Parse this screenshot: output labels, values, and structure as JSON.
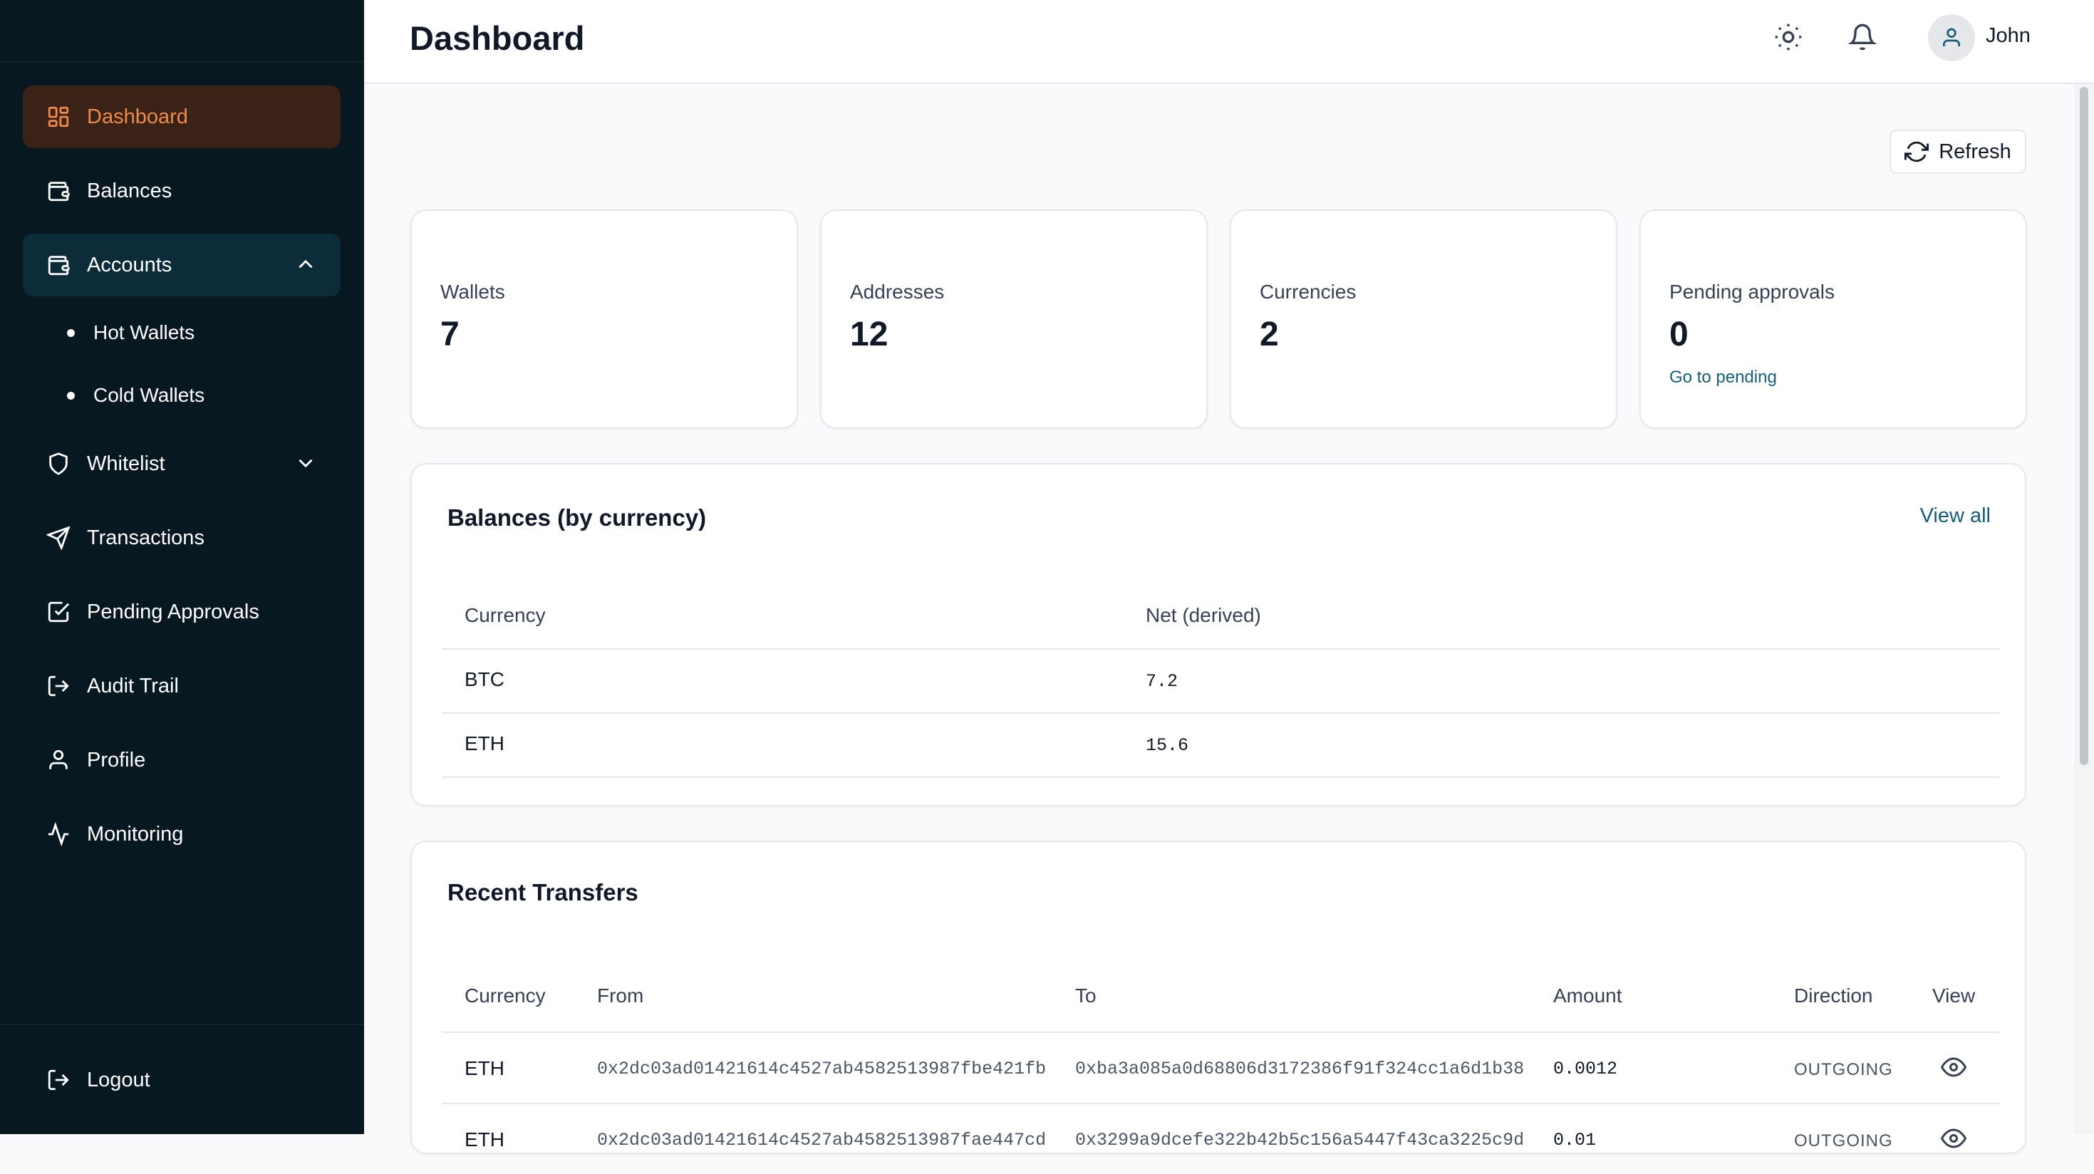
{
  "sidebar": {
    "items": [
      {
        "label": "Dashboard",
        "icon": "grid-icon"
      },
      {
        "label": "Balances",
        "icon": "wallet-icon"
      },
      {
        "label": "Accounts",
        "icon": "wallet-icon"
      },
      {
        "label": "Whitelist",
        "icon": "shield-icon"
      },
      {
        "label": "Transactions",
        "icon": "send-icon"
      },
      {
        "label": "Pending Approvals",
        "icon": "check-square-icon"
      },
      {
        "label": "Audit Trail",
        "icon": "log-out-icon"
      },
      {
        "label": "Profile",
        "icon": "user-icon"
      },
      {
        "label": "Monitoring",
        "icon": "activity-icon"
      }
    ],
    "accounts_sub": [
      "Hot Wallets",
      "Cold Wallets"
    ],
    "logout_label": "Logout"
  },
  "header": {
    "title": "Dashboard",
    "user_name": "John"
  },
  "toolbar": {
    "refresh_label": "Refresh"
  },
  "stats": [
    {
      "label": "Wallets",
      "value": "7"
    },
    {
      "label": "Addresses",
      "value": "12"
    },
    {
      "label": "Currencies",
      "value": "2"
    },
    {
      "label": "Pending approvals",
      "value": "0",
      "link": "Go to pending"
    }
  ],
  "balances": {
    "title": "Balances (by currency)",
    "view_all": "View all",
    "columns": [
      "Currency",
      "Net (derived)"
    ],
    "rows": [
      {
        "currency": "BTC",
        "net": "7.2"
      },
      {
        "currency": "ETH",
        "net": "15.6"
      }
    ]
  },
  "transfers": {
    "title": "Recent Transfers",
    "columns": [
      "Currency",
      "From",
      "To",
      "Amount",
      "Direction",
      "View"
    ],
    "rows": [
      {
        "currency": "ETH",
        "from": "0x2dc03ad01421614c4527ab4582513987fbe421fb",
        "to": "0xba3a085a0d68806d3172386f91f324cc1a6d1b38",
        "amount": "0.0012",
        "direction": "OUTGOING"
      },
      {
        "currency": "ETH",
        "from": "0x2dc03ad01421614c4527ab4582513987fae447cd",
        "to": "0x3299a9dcefe322b42b5c156a5447f43ca3225c9d",
        "amount": "0.01",
        "direction": "OUTGOING"
      }
    ]
  },
  "colors": {
    "sidebar_bg": "#071820",
    "active_bg": "#3a2216",
    "active_text": "#f08a4b",
    "open_bg": "#0d2c39",
    "link": "#155e75"
  }
}
